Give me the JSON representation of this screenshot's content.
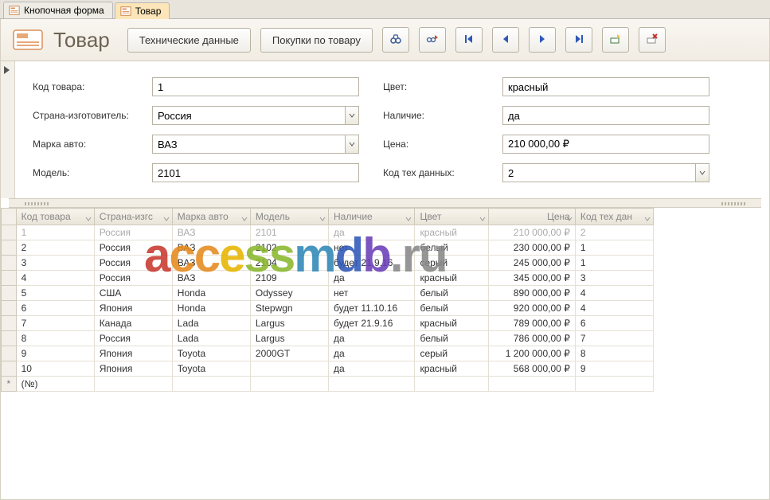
{
  "tabs": [
    {
      "label": "Кнопочная форма",
      "active": false
    },
    {
      "label": "Товар",
      "active": true
    }
  ],
  "header": {
    "title": "Товар",
    "buttons": {
      "tech": "Технические данные",
      "purchases": "Покупки по товару"
    }
  },
  "form": {
    "labels": {
      "code": "Код товара:",
      "country": "Страна-изготовитель:",
      "brand": "Марка авто:",
      "model": "Модель:",
      "color": "Цвет:",
      "availability": "Наличие:",
      "price": "Цена:",
      "techcode": "Код тех данных:"
    },
    "values": {
      "code": "1",
      "country": "Россия",
      "brand": "ВАЗ",
      "model": "2101",
      "color": "красный",
      "availability": "да",
      "price": "210 000,00 ₽",
      "techcode": "2"
    }
  },
  "columns": [
    "Код товара",
    "Страна-изгс",
    "Марка авто",
    "Модель",
    "Наличие",
    "Цвет",
    "Цена",
    "Код тех дан"
  ],
  "rows": [
    {
      "code": "1",
      "country": "Россия",
      "brand": "ВАЗ",
      "model": "2101",
      "avail": "да",
      "color": "красный",
      "price": "210 000,00 ₽",
      "tech": "2",
      "selected": true
    },
    {
      "code": "2",
      "country": "Россия",
      "brand": "ВАЗ",
      "model": "2102",
      "avail": "нет",
      "color": "белый",
      "price": "230 000,00 ₽",
      "tech": "1"
    },
    {
      "code": "3",
      "country": "Россия",
      "brand": "ВАЗ",
      "model": "2104",
      "avail": "будет 21.9.16",
      "color": "серый",
      "price": "245 000,00 ₽",
      "tech": "1"
    },
    {
      "code": "4",
      "country": "Россия",
      "brand": "ВАЗ",
      "model": "2109",
      "avail": "да",
      "color": "красный",
      "price": "345 000,00 ₽",
      "tech": "3"
    },
    {
      "code": "5",
      "country": "США",
      "brand": "Honda",
      "model": "Odyssey",
      "avail": "нет",
      "color": "белый",
      "price": "890 000,00 ₽",
      "tech": "4"
    },
    {
      "code": "6",
      "country": "Япония",
      "brand": "Honda",
      "model": "Stepwgn",
      "avail": "будет 11.10.16",
      "color": "белый",
      "price": "920 000,00 ₽",
      "tech": "4"
    },
    {
      "code": "7",
      "country": "Канада",
      "brand": "Lada",
      "model": "Largus",
      "avail": "будет 21.9.16",
      "color": "красный",
      "price": "789 000,00 ₽",
      "tech": "6"
    },
    {
      "code": "8",
      "country": "Россия",
      "brand": "Lada",
      "model": "Largus",
      "avail": "да",
      "color": "белый",
      "price": "786 000,00 ₽",
      "tech": "7"
    },
    {
      "code": "9",
      "country": "Япония",
      "brand": "Toyota",
      "model": "2000GT",
      "avail": "да",
      "color": "серый",
      "price": "1 200 000,00 ₽",
      "tech": "8"
    },
    {
      "code": "10",
      "country": "Япония",
      "brand": "Toyota",
      "model": "",
      "avail": "да",
      "color": "красный",
      "price": "568 000,00 ₽",
      "tech": "9"
    }
  ],
  "newrow_label": "(№)",
  "colors": {
    "accent": "#f9a23a"
  }
}
